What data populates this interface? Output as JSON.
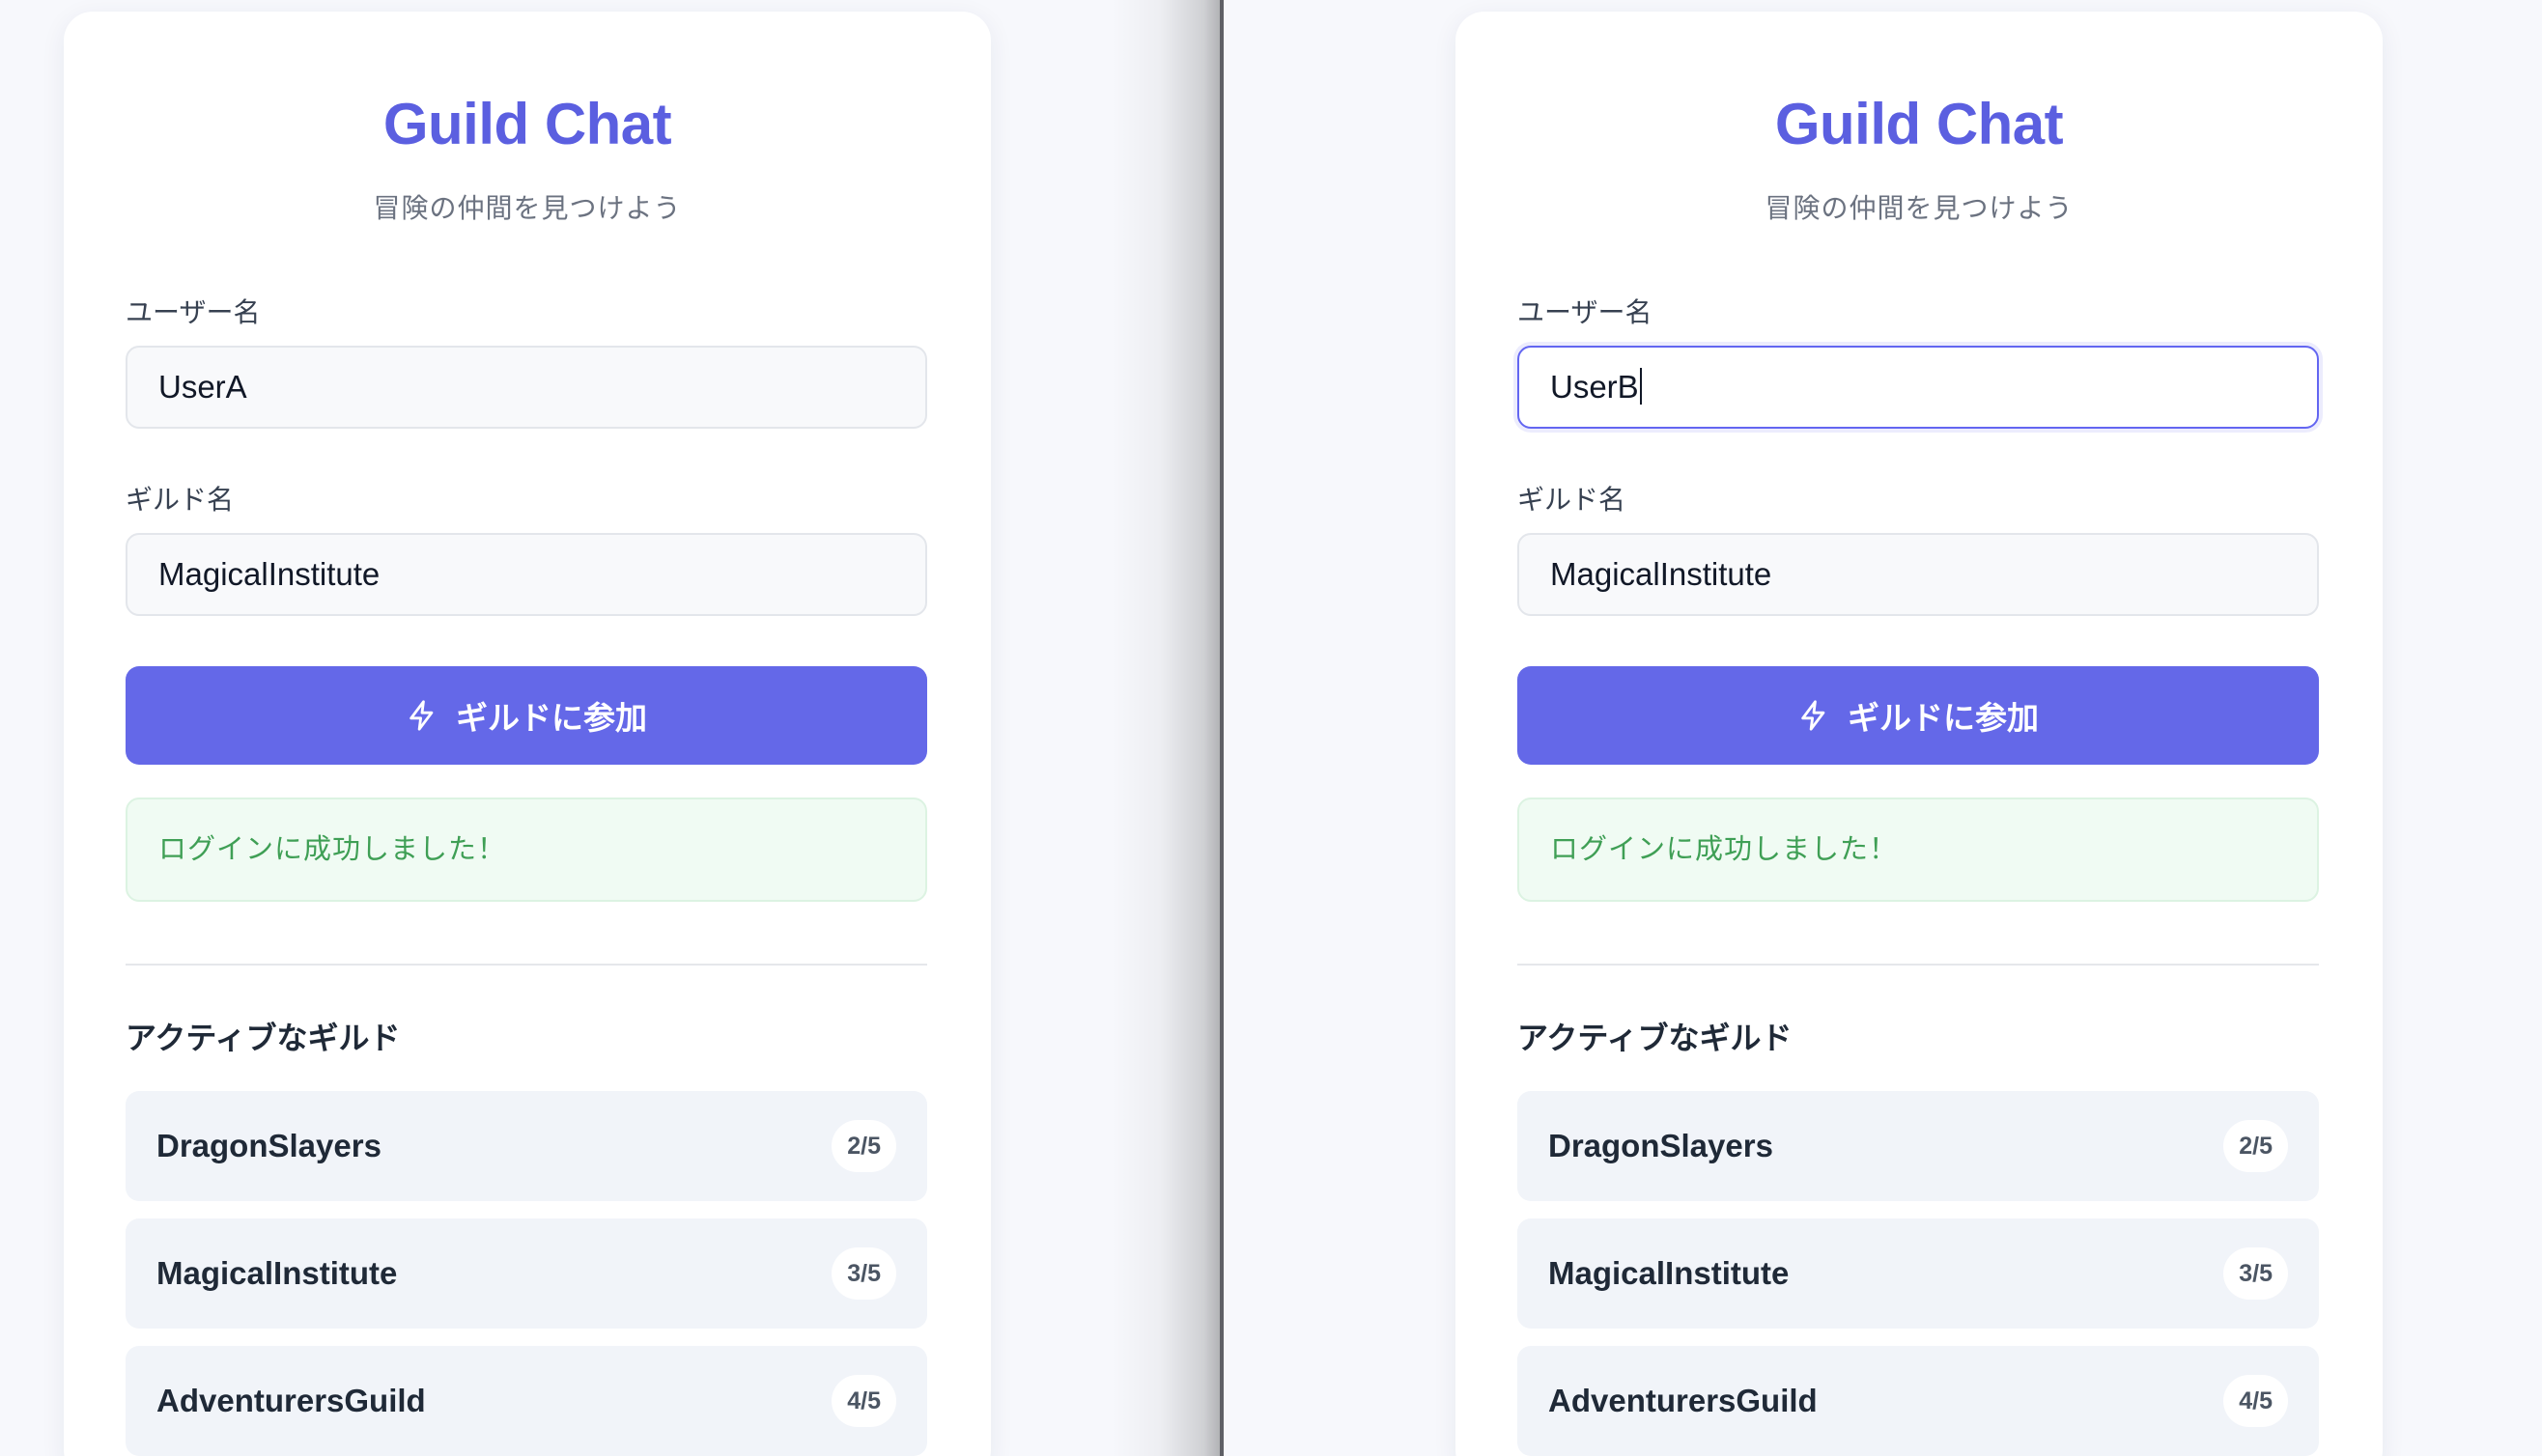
{
  "panes": [
    {
      "title": "Guild Chat",
      "subtitle": "冒険の仲間を見つけよう",
      "username_label": "ユーザー名",
      "username_value": "UserA",
      "guild_label": "ギルド名",
      "guild_value": "MagicalInstitute",
      "join_button": "ギルドに参加",
      "success_message": "ログインに成功しました！",
      "active_guilds_title": "アクティブなギルド",
      "guilds": [
        {
          "name": "DragonSlayers",
          "count": "2/5"
        },
        {
          "name": "MagicalInstitute",
          "count": "3/5"
        },
        {
          "name": "AdventurersGuild",
          "count": "4/5"
        }
      ]
    },
    {
      "title": "Guild Chat",
      "subtitle": "冒険の仲間を見つけよう",
      "username_label": "ユーザー名",
      "username_value": "UserB",
      "guild_label": "ギルド名",
      "guild_value": "MagicalInstitute",
      "join_button": "ギルドに参加",
      "success_message": "ログインに成功しました！",
      "active_guilds_title": "アクティブなギルド",
      "guilds": [
        {
          "name": "DragonSlayers",
          "count": "2/5"
        },
        {
          "name": "MagicalInstitute",
          "count": "3/5"
        },
        {
          "name": "AdventurersGuild",
          "count": "4/5"
        }
      ]
    }
  ],
  "icons": {
    "join_button_icon": "lightning-bolt-icon"
  },
  "colors": {
    "accent": "#6468e8",
    "title": "#5b5fe0",
    "success_text": "#3f9f55",
    "success_bg": "#f0fbf3"
  }
}
